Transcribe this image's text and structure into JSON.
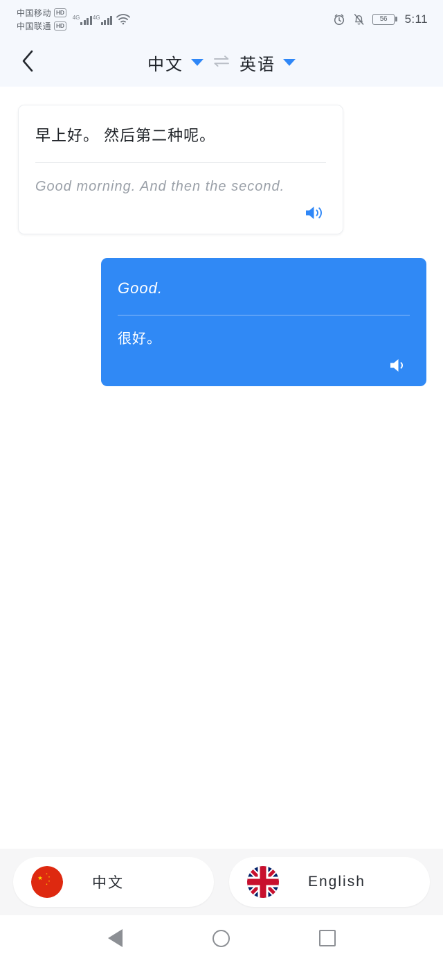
{
  "status_bar": {
    "carriers": [
      {
        "name": "中国移动",
        "badge": "HD",
        "network": "4G"
      },
      {
        "name": "中国联通",
        "badge": "HD",
        "network": "4G"
      }
    ],
    "wifi_icon": "wifi-icon",
    "alarm_icon": "alarm-icon",
    "mute_icon": "bell-muted-icon",
    "battery_level": "56",
    "time": "5:11"
  },
  "header": {
    "back_icon": "back-chevron-icon",
    "source_language": "中文",
    "target_language": "英语",
    "swap_icon": "swap-arrows-icon",
    "caret_icon": "chevron-down-icon",
    "accent_color": "#2f87f7"
  },
  "conversation": {
    "messages": [
      {
        "side": "left",
        "primary_text": "早上好。 然后第二种呢。",
        "secondary_text": "Good morning. And then the second.",
        "speaker_icon": "speaker-icon"
      },
      {
        "side": "right",
        "primary_text": "Good.",
        "secondary_text": "很好。",
        "speaker_icon": "speaker-icon"
      }
    ],
    "bubble_color": "#3089f5"
  },
  "language_bar": {
    "buttons": [
      {
        "label": "中文",
        "flag_icon": "china-flag-icon"
      },
      {
        "label": "English",
        "flag_icon": "uk-flag-icon"
      }
    ]
  },
  "nav_bar": {
    "back_icon": "android-back-icon",
    "home_icon": "android-home-icon",
    "recents_icon": "android-recents-icon"
  }
}
